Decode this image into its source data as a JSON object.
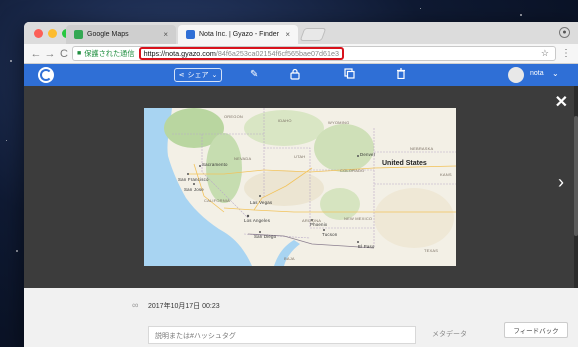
{
  "browser": {
    "tabs": [
      {
        "title": "Google Maps",
        "favicon_color": "#34a853"
      },
      {
        "title": "Nota Inc. | Gyazo - Finder",
        "favicon_color": "#2f6fd6"
      }
    ],
    "secure_label": "保護された通信",
    "url_host": "https://nota.gyazo.com",
    "url_path": "/84f6a253ca02154f6cf565bae07d61e3",
    "highlight_color": "#d8121c"
  },
  "gyazo": {
    "share_label": "シェア",
    "username": "nota",
    "brand_color": "#2f6fd6"
  },
  "map": {
    "labels": {
      "oregon": "OREGON",
      "idaho": "IDAHO",
      "wyoming": "WYOMING",
      "nebraska": "NEBRASKA",
      "nevada": "NEVADA",
      "utah": "UTAH",
      "colorado": "COLORADO",
      "kansas": "KANS",
      "california": "CALIFORNIA",
      "arizona": "ARIZONA",
      "new_mexico": "NEW MEXICO",
      "texas": "TEXAS",
      "baja": "BAJA",
      "sacramento": "Sacramento",
      "san_francisco": "San Francisco",
      "san_jose": "San Jose",
      "las_vegas": "Las Vegas",
      "los_angeles": "Los Angeles",
      "san_diego": "San Diego",
      "phoenix": "Phoenix",
      "tucson": "Tucson",
      "el_paso": "El Paso",
      "denver": "Denver",
      "united_states": "United States"
    }
  },
  "info": {
    "date": "2017年10月17日 00:23",
    "description_placeholder": "説明または#ハッシュタグ",
    "metadata_label": "メタデータ",
    "feedback_label": "フィードバック"
  }
}
